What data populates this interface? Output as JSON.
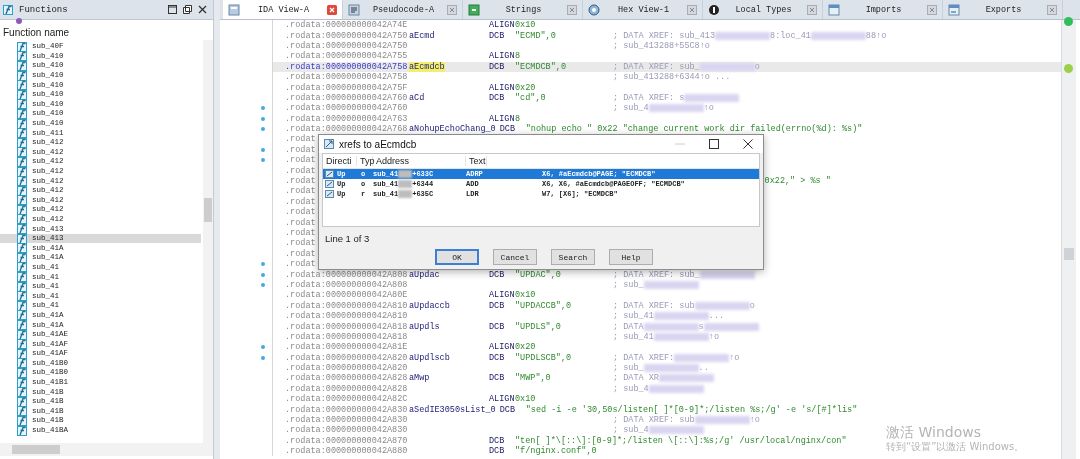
{
  "functions": {
    "title": "Functions",
    "column": "Function name",
    "items": [
      {
        "name": "sub_40F",
        "selected": false
      },
      {
        "name": "sub_410",
        "selected": false
      },
      {
        "name": "sub_410",
        "selected": false
      },
      {
        "name": "sub_410",
        "selected": false
      },
      {
        "name": "sub_410",
        "selected": false
      },
      {
        "name": "sub_410",
        "selected": false
      },
      {
        "name": "sub_410",
        "selected": false
      },
      {
        "name": "sub_410",
        "selected": false
      },
      {
        "name": "sub_410",
        "selected": false
      },
      {
        "name": "sub_411",
        "selected": false
      },
      {
        "name": "sub_412",
        "selected": false
      },
      {
        "name": "sub_412",
        "selected": false
      },
      {
        "name": "sub_412",
        "selected": false
      },
      {
        "name": "sub_412",
        "selected": false
      },
      {
        "name": "sub_412",
        "selected": false
      },
      {
        "name": "sub_412",
        "selected": false
      },
      {
        "name": "sub_412",
        "selected": false
      },
      {
        "name": "sub_412",
        "selected": false
      },
      {
        "name": "sub_412",
        "selected": false
      },
      {
        "name": "sub_413",
        "selected": false
      },
      {
        "name": "sub_413",
        "selected": true
      },
      {
        "name": "sub_41A",
        "selected": false
      },
      {
        "name": "sub_41A",
        "selected": false
      },
      {
        "name": "sub_41",
        "selected": false
      },
      {
        "name": "sub_41",
        "selected": false
      },
      {
        "name": "sub_41",
        "selected": false
      },
      {
        "name": "sub_41",
        "selected": false
      },
      {
        "name": "sub_41",
        "selected": false
      },
      {
        "name": "sub_41A",
        "selected": false
      },
      {
        "name": "sub_41A",
        "selected": false
      },
      {
        "name": "sub_41AE",
        "selected": false
      },
      {
        "name": "sub_41AF",
        "selected": false
      },
      {
        "name": "sub_41AF",
        "selected": false
      },
      {
        "name": "sub_41B0",
        "selected": false
      },
      {
        "name": "sub_41B0",
        "selected": false
      },
      {
        "name": "sub_41B1",
        "selected": false
      },
      {
        "name": "sub_41B",
        "selected": false
      },
      {
        "name": "sub_41B",
        "selected": false
      },
      {
        "name": "sub_41B",
        "selected": false
      },
      {
        "name": "sub_41B",
        "selected": false
      },
      {
        "name": "sub_41BA",
        "selected": false
      }
    ]
  },
  "tabs": [
    {
      "label": "IDA View-A",
      "selected": true
    },
    {
      "label": "Pseudocode-A",
      "selected": false
    },
    {
      "label": "Strings",
      "selected": false
    },
    {
      "label": "Hex View-1",
      "selected": false
    },
    {
      "label": "Local Types",
      "selected": false
    },
    {
      "label": "Imports",
      "selected": false
    },
    {
      "label": "Exports",
      "selected": false
    }
  ],
  "code": {
    "rows": [
      {
        "kind": "line",
        "address": ".rodata:000000000042A74E",
        "mnemonic": "ALIGN",
        "operand": "0x10",
        "selected": false,
        "marked": false
      },
      {
        "kind": "line",
        "address": ".rodata:000000000042A750",
        "label": "aEcmd",
        "mnemonic": "DCB",
        "operand": "\"ECMD\",0",
        "comment": [
          {
            "kind": "text",
            "text": "; DATA XREF: sub_413"
          },
          {
            "kind": "redaction"
          },
          {
            "kind": "text",
            "text": "8:loc_41"
          },
          {
            "kind": "redaction"
          },
          {
            "kind": "text",
            "text": "88↑o"
          }
        ],
        "selected": false,
        "marked": false
      },
      {
        "kind": "line",
        "address": ".rodata:000000000042A750",
        "comment": [
          {
            "kind": "text",
            "text": "; sub_413288+55C8↑o"
          }
        ],
        "selected": false,
        "marked": false
      },
      {
        "kind": "line",
        "address": ".rodata:000000000042A755",
        "mnemonic": "ALIGN",
        "operand": "8",
        "selected": false,
        "marked": false
      },
      {
        "kind": "line",
        "address": ".rodata:000000000042A758",
        "label": "aEcmdcb",
        "mnemonic": "DCB",
        "operand": "\"ECMDCB\",0",
        "comment": [
          {
            "kind": "text",
            "text": "; DATA XREF: sub_"
          },
          {
            "kind": "redaction"
          },
          {
            "kind": "text",
            "text": "o"
          }
        ],
        "selected": true,
        "marked": false
      },
      {
        "kind": "line",
        "address": ".rodata:000000000042A758",
        "comment": [
          {
            "kind": "text",
            "text": "; sub_413288+6344↑o ..."
          }
        ],
        "selected": false,
        "marked": false
      },
      {
        "kind": "line",
        "address": ".rodata:000000000042A75F",
        "mnemonic": "ALIGN",
        "operand": "0x20",
        "selected": false,
        "marked": false
      },
      {
        "kind": "line",
        "address": ".rodata:000000000042A760",
        "label": "aCd",
        "mnemonic": "DCB",
        "operand": "\"cd\",0",
        "comment": [
          {
            "kind": "text",
            "text": "; DATA XREF: s"
          },
          {
            "kind": "redaction"
          }
        ],
        "selected": false,
        "marked": false
      },
      {
        "kind": "line",
        "address": ".rodata:000000000042A760",
        "comment": [
          {
            "kind": "text",
            "text": "; sub_4"
          },
          {
            "kind": "redaction"
          },
          {
            "kind": "text",
            "text": "↑o"
          }
        ],
        "selected": false,
        "marked": true
      },
      {
        "kind": "line",
        "address": ".rodata:000000000042A763",
        "mnemonic": "ALIGN",
        "operand": "8",
        "selected": false,
        "marked": true
      },
      {
        "kind": "line",
        "address": ".rodata:000000000042A768",
        "label": "aNohupEchoChang_0",
        "mnemonic": "DCB",
        "operand": "\"nohup echo \" 0x22 \"change current work dir failed(errno(%d): %s)\"",
        "selected": false,
        "marked": true
      },
      {
        "kind": "covered",
        "address": ".rodat",
        "selected": false,
        "marked": false
      },
      {
        "kind": "covered",
        "address": ".rodat",
        "selected": false,
        "marked": true
      },
      {
        "kind": "covered",
        "address": ".rodat",
        "selected": false,
        "marked": true
      },
      {
        "kind": "covered",
        "address": ".rodat",
        "selected": false,
        "marked": false
      },
      {
        "kind": "covered",
        "address": ".rodat",
        "tail": "0x22,\" > %s \"",
        "selected": false,
        "marked": false
      },
      {
        "kind": "covered",
        "address": ".rodat",
        "selected": false,
        "marked": false
      },
      {
        "kind": "covered",
        "address": ".rodat",
        "selected": false,
        "marked": false
      },
      {
        "kind": "covered",
        "address": ".rodat",
        "selected": false,
        "marked": false
      },
      {
        "kind": "covered",
        "address": ".rodat",
        "selected": false,
        "marked": false
      },
      {
        "kind": "covered",
        "address": ".rodat",
        "selected": false,
        "marked": false
      },
      {
        "kind": "covered",
        "address": ".rodat",
        "selected": false,
        "marked": false
      },
      {
        "kind": "covered",
        "address": ".rodat",
        "selected": false,
        "marked": false
      },
      {
        "kind": "covered",
        "address": ".rodat",
        "selected": false,
        "marked": true
      },
      {
        "kind": "line",
        "address": ".rodata:000000000042A808",
        "label": "aUpdac",
        "mnemonic": "DCB",
        "operand": "\"UPDAC\",0",
        "comment": [
          {
            "kind": "text",
            "text": "; DATA XREF: sub_"
          },
          {
            "kind": "redaction"
          }
        ],
        "selected": false,
        "marked": true
      },
      {
        "kind": "line",
        "address": ".rodata:000000000042A808",
        "comment": [
          {
            "kind": "text",
            "text": "; sub_"
          },
          {
            "kind": "redaction"
          }
        ],
        "selected": false,
        "marked": true
      },
      {
        "kind": "line",
        "address": ".rodata:000000000042A80E",
        "mnemonic": "ALIGN",
        "operand": "0x10",
        "selected": false,
        "marked": false
      },
      {
        "kind": "line",
        "address": ".rodata:000000000042A810",
        "label": "aUpdaccb",
        "mnemonic": "DCB",
        "operand": "\"UPDACCB\",0",
        "comment": [
          {
            "kind": "text",
            "text": "; DATA XREF: sub"
          },
          {
            "kind": "redaction"
          },
          {
            "kind": "text",
            "text": "o"
          }
        ],
        "selected": false,
        "marked": false
      },
      {
        "kind": "line",
        "address": ".rodata:000000000042A810",
        "comment": [
          {
            "kind": "text",
            "text": "; sub_41"
          },
          {
            "kind": "redaction"
          },
          {
            "kind": "text",
            "text": "..."
          }
        ],
        "selected": false,
        "marked": false
      },
      {
        "kind": "line",
        "address": ".rodata:000000000042A818",
        "label": "aUpdls",
        "mnemonic": "DCB",
        "operand": "\"UPDLS\",0",
        "comment": [
          {
            "kind": "text",
            "text": "; DATA"
          },
          {
            "kind": "redaction"
          },
          {
            "kind": "text",
            "text": "s"
          },
          {
            "kind": "redaction"
          }
        ],
        "selected": false,
        "marked": false
      },
      {
        "kind": "line",
        "address": ".rodata:000000000042A818",
        "comment": [
          {
            "kind": "text",
            "text": "; sub_41"
          },
          {
            "kind": "redaction"
          },
          {
            "kind": "text",
            "text": "↑o"
          }
        ],
        "selected": false,
        "marked": false
      },
      {
        "kind": "line",
        "address": ".rodata:000000000042A81E",
        "mnemonic": "ALIGN",
        "operand": "0x20",
        "selected": false,
        "marked": true
      },
      {
        "kind": "line",
        "address": ".rodata:000000000042A820",
        "label": "aUpdlscb",
        "mnemonic": "DCB",
        "operand": "\"UPDLSCB\",0",
        "comment": [
          {
            "kind": "text",
            "text": "; DATA XREF:"
          },
          {
            "kind": "redaction"
          },
          {
            "kind": "text",
            "text": "↑o"
          }
        ],
        "selected": false,
        "marked": true
      },
      {
        "kind": "line",
        "address": ".rodata:000000000042A820",
        "comment": [
          {
            "kind": "text",
            "text": "; sub_"
          },
          {
            "kind": "redaction"
          },
          {
            "kind": "text",
            "text": ".."
          }
        ],
        "selected": false,
        "marked": false
      },
      {
        "kind": "line",
        "address": ".rodata:000000000042A828",
        "label": "aMwp",
        "mnemonic": "DCB",
        "operand": "\"MWP\",0",
        "comment": [
          {
            "kind": "text",
            "text": "; DATA XR"
          },
          {
            "kind": "redaction"
          }
        ],
        "selected": false,
        "marked": false
      },
      {
        "kind": "line",
        "address": ".rodata:000000000042A828",
        "comment": [
          {
            "kind": "text",
            "text": "; sub_4"
          },
          {
            "kind": "redaction"
          }
        ],
        "selected": false,
        "marked": false
      },
      {
        "kind": "line",
        "address": ".rodata:000000000042A82C",
        "mnemonic": "ALIGN",
        "operand": "0x10",
        "selected": false,
        "marked": false
      },
      {
        "kind": "line",
        "address": ".rodata:000000000042A830",
        "label": "aSedIE3050sList_0",
        "mnemonic": "DCB",
        "operand": "\"sed -i -e '30,50s/listen[ ]*[0-9]*;/listen  %s;/g' -e 's/[#]*lis\"",
        "selected": false,
        "marked": false
      },
      {
        "kind": "line",
        "address": ".rodata:000000000042A830",
        "comment": [
          {
            "kind": "text",
            "text": "; DATA XREF: sub"
          },
          {
            "kind": "redaction"
          },
          {
            "kind": "text",
            "text": "↑o"
          }
        ],
        "selected": false,
        "marked": false
      },
      {
        "kind": "line",
        "address": ".rodata:000000000042A830",
        "comment": [
          {
            "kind": "text",
            "text": "; sub_4"
          },
          {
            "kind": "redaction"
          }
        ],
        "selected": false,
        "marked": false
      },
      {
        "kind": "line",
        "address": ".rodata:000000000042A870",
        "mnemonic": "DCB",
        "operand": "\"ten[ ]*\\[::\\]:[0-9]*;/listen  \\[::\\]:%s;/g' /usr/local/nginx/con\"",
        "selected": false,
        "marked": false
      },
      {
        "kind": "line",
        "address": ".rodata:000000000042A880",
        "mnemonic": "DCB",
        "operand": "\"f/nginx.conf\",0",
        "selected": false,
        "marked": false
      }
    ]
  },
  "dialog": {
    "title": "xrefs to aEcmdcb",
    "columns": [
      "Directi",
      "Typ",
      "Address",
      "Text"
    ],
    "rows": [
      {
        "direction": "Up",
        "type": "o",
        "address_start": "sub_41",
        "address_end": "+633C",
        "instruction": "ADRP",
        "operands": "X6, #aEcmdcb@PAGE; \"ECMDCB\"",
        "selected": true
      },
      {
        "direction": "Up",
        "type": "o",
        "address_start": "sub_41",
        "address_end": "+6344",
        "instruction": "ADD",
        "operands": "X6, X6, #aEcmdcb@PAGEOFF; \"ECMDCB\"",
        "selected": false
      },
      {
        "direction": "Up",
        "type": "r",
        "address_start": "sub_41",
        "address_end": "+635C",
        "instruction": "LDR",
        "operands": "W7, [X6]; \"ECMDCB\"",
        "selected": false
      }
    ],
    "status": "Line 1 of 3",
    "buttons": [
      {
        "label": "OK",
        "default": true
      },
      {
        "label": "Cancel",
        "default": false
      },
      {
        "label": "Search",
        "default": false
      },
      {
        "label": "Help",
        "default": false
      }
    ]
  },
  "activation_notice": {
    "title": "激活 Windows",
    "text": "转到“设置”以激活 Windows。"
  }
}
